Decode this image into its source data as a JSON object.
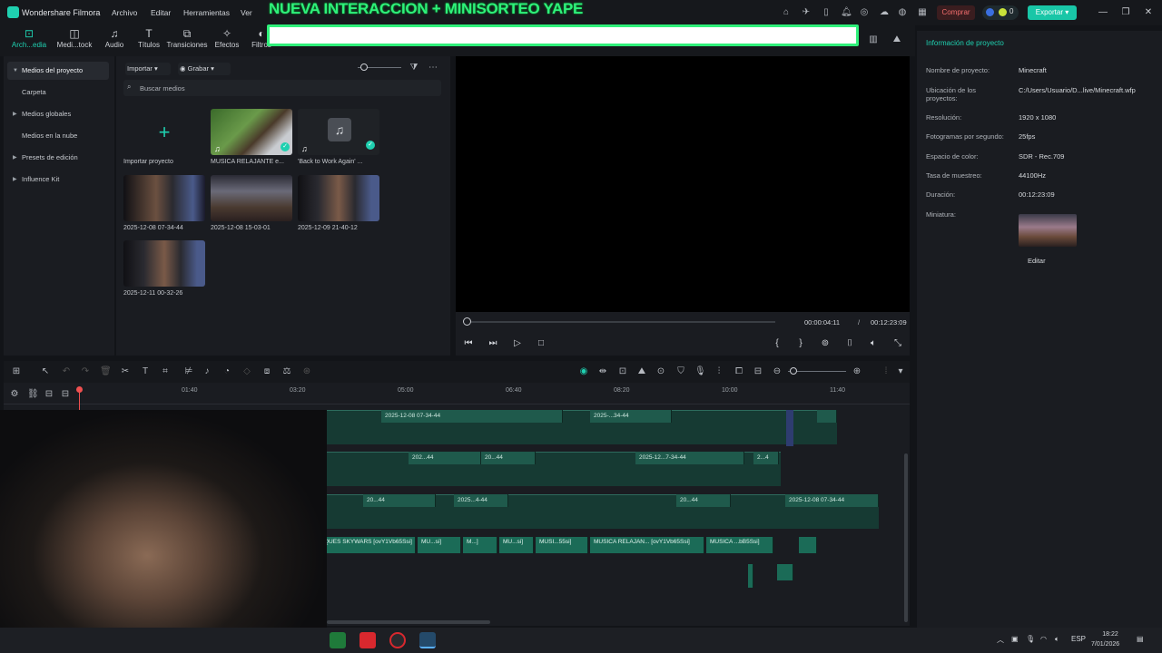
{
  "titlebar": {
    "app_name": "Wondershare Filmora",
    "menu": [
      "Archivo",
      "Editar",
      "Herramientas",
      "Ver"
    ],
    "buy_label": "Comprar",
    "credits": "0",
    "export_label": "Exportar"
  },
  "banner": {
    "text": "NUEVA INTERACCION + MINISORTEO YAPE"
  },
  "toolbar": {
    "tabs": [
      {
        "label": "Arch...edia",
        "icon": "media-icon"
      },
      {
        "label": "Medi...tock",
        "icon": "stock-icon"
      },
      {
        "label": "Audio",
        "icon": "audio-icon"
      },
      {
        "label": "Títulos",
        "icon": "titles-icon"
      },
      {
        "label": "Transiciones",
        "icon": "transitions-icon"
      },
      {
        "label": "Efectos",
        "icon": "effects-icon"
      },
      {
        "label": "Filtros",
        "icon": "filters-icon"
      }
    ]
  },
  "sidebar": {
    "items": [
      {
        "label": "Medios del proyecto",
        "expandable": true
      },
      {
        "label": "Carpeta",
        "expandable": false
      },
      {
        "label": "Medios globales",
        "expandable": true
      },
      {
        "label": "Medios en la nube",
        "expandable": false
      },
      {
        "label": "Presets de edición",
        "expandable": true
      },
      {
        "label": "Influence Kit",
        "expandable": true
      }
    ]
  },
  "media": {
    "import_label": "Importar",
    "record_label": "Grabar",
    "search_placeholder": "Buscar medios",
    "items": [
      {
        "caption": "Importar proyecto",
        "kind": "import"
      },
      {
        "caption": "MUSICA RELAJANTE e...",
        "kind": "video"
      },
      {
        "caption": "'Back to Work Again' ...",
        "kind": "audio"
      },
      {
        "caption": "2025-12-08 07-34-44",
        "kind": "video"
      },
      {
        "caption": "2025-12-08 15-03-01",
        "kind": "video"
      },
      {
        "caption": "2025-12-09 21-40-12",
        "kind": "video"
      },
      {
        "caption": "2025-12-11 00-32-26",
        "kind": "video"
      }
    ]
  },
  "preview": {
    "current_time": "00:00:04:11",
    "separator": "/",
    "total_time": "00:12:23:09",
    "progress": 0.006
  },
  "info": {
    "heading": "Información de proyecto",
    "fields": [
      {
        "label": "Nombre de proyecto:",
        "value": "Minecraft"
      },
      {
        "label": "Ubicación de los proyectos:",
        "value": "C:/Users/Usuario/D...live/Minecraft.wfp"
      },
      {
        "label": "Resolución:",
        "value": "1920 x 1080"
      },
      {
        "label": "Fotogramas por segundo:",
        "value": "25fps"
      },
      {
        "label": "Espacio de color:",
        "value": "SDR - Rec.709"
      },
      {
        "label": "Tasa de muestreo:",
        "value": "44100Hz"
      },
      {
        "label": "Duración:",
        "value": "00:12:23:09"
      },
      {
        "label": "Miniatura:",
        "value": ""
      }
    ],
    "edit_label": "Editar"
  },
  "timeline": {
    "ruler": [
      "01:40",
      "03:20",
      "05:00",
      "06:40",
      "08:20",
      "10:00",
      "11:40"
    ],
    "video_clips_1": [
      "2025-12-08 07-34-44",
      "2025-...34-44"
    ],
    "video_clips_2": [
      "202...44",
      "20...44",
      "2025-12...7-34-44",
      "2...4"
    ],
    "video_clips_3": [
      "20...44",
      "2025...4-44",
      "20...44",
      "2025-12-08 07-34-44"
    ],
    "audio_clips": [
      "ECRAFT con BLOQUES SKYWARS [ovY1Vb65Ssi]",
      "MU...si]",
      "M...]",
      "MU...si]",
      "MUSI...55si]",
      "MUSICA RELAJAN... [ovY1Vb65Ssi]",
      "MUSICA ...bB5Ssi]"
    ]
  },
  "taskbar": {
    "lang": "ESP",
    "time": "18:22",
    "date": "7/01/2026"
  }
}
